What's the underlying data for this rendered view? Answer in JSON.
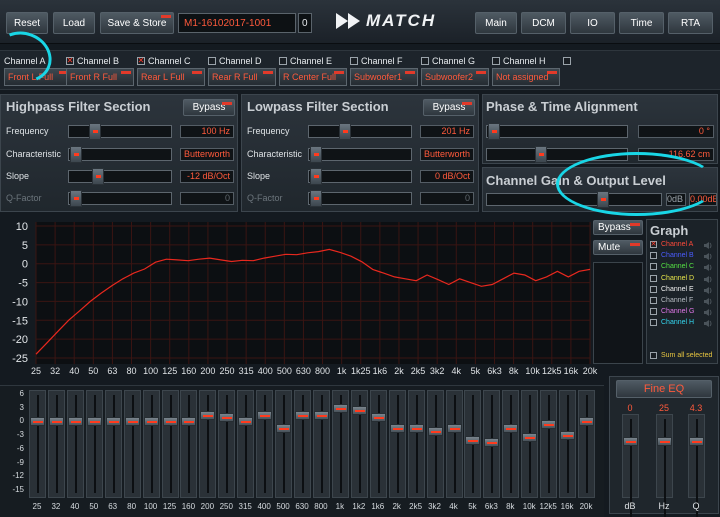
{
  "top": {
    "reset": "Reset",
    "load": "Load",
    "save_store": "Save & Store",
    "preset_name": "M1-16102017-1001",
    "preset_slot": "0",
    "logo": "MATCH",
    "nav": [
      "Main",
      "DCM",
      "IO",
      "Time",
      "RTA"
    ]
  },
  "channels": [
    {
      "name": "Channel A",
      "checked": false,
      "output": "Front L Full"
    },
    {
      "name": "Channel B",
      "checked": true,
      "output": "Front R Full"
    },
    {
      "name": "Channel C",
      "checked": true,
      "output": "Rear L Full"
    },
    {
      "name": "Channel D",
      "checked": false,
      "output": "Rear R Full"
    },
    {
      "name": "Channel E",
      "checked": false,
      "output": "R Center Full"
    },
    {
      "name": "Channel F",
      "checked": false,
      "output": "Subwoofer1"
    },
    {
      "name": "Channel G",
      "checked": false,
      "output": "Subwoofer2"
    },
    {
      "name": "Channel H",
      "checked": false,
      "output": "Not assigned"
    }
  ],
  "highpass": {
    "title": "Highpass Filter Section",
    "bypass": "Bypass",
    "labels": [
      "Frequency",
      "Characteristic",
      "Slope",
      "Q-Factor"
    ],
    "values": [
      "100 Hz",
      "Butterworth",
      "-12 dB/Oct",
      "0"
    ]
  },
  "lowpass": {
    "title": "Lowpass Filter Section",
    "bypass": "Bypass",
    "labels": [
      "Frequency",
      "Characteristic",
      "Slope",
      "Q-Factor"
    ],
    "values": [
      "201 Hz",
      "Butterworth",
      "0 dB/Oct",
      "0"
    ]
  },
  "phase": {
    "title": "Phase & Time Alignment",
    "phase_value": "0 °",
    "time_value": "116.62 cm"
  },
  "gain": {
    "title": "Channel Gain & Output Level",
    "left_value": "0dB",
    "right_value": "0.00dB"
  },
  "graph": {
    "y_ticks": [
      "10",
      "5",
      "0",
      "-5",
      "-10",
      "-15",
      "-20",
      "-25"
    ],
    "x_ticks": [
      "25",
      "32",
      "40",
      "50",
      "63",
      "80",
      "100",
      "125",
      "160",
      "200",
      "250",
      "315",
      "400",
      "500",
      "630",
      "800",
      "1k",
      "1k25",
      "1k6",
      "2k",
      "2k5",
      "3k2",
      "4k",
      "5k",
      "6k3",
      "8k",
      "10k",
      "12k5",
      "16k",
      "20k"
    ],
    "curve_db": [
      -24,
      -21,
      -18,
      -15,
      -12.5,
      -10,
      -7.8,
      -5.8,
      -4,
      -2.5,
      -1.4,
      0.4,
      1.2,
      1.0,
      0.8,
      1.2,
      1.5,
      1.0,
      0.6,
      0.9,
      0.8,
      1.5,
      2.0,
      2.5,
      2.4,
      2.9,
      3.2,
      3.8,
      3.0,
      2.0,
      0.5,
      -1.5,
      -2.5,
      -3.5,
      -4.0,
      -4.5,
      -3.0,
      -4.2,
      -5.5,
      -4.0,
      -5.0,
      -6.0,
      -5.5,
      -4.0,
      -2.5,
      -3.0,
      -4.5,
      -3.5,
      -2.0,
      -3.5,
      -2.0,
      -1.5
    ]
  },
  "side": {
    "bypass": "Bypass",
    "mute": "Mute",
    "graph_title": "Graph",
    "legend": [
      {
        "name": "Channel A",
        "color": "#ff4a3a",
        "checked": true
      },
      {
        "name": "Channel B",
        "color": "#4a5cff",
        "checked": false
      },
      {
        "name": "Channel C",
        "color": "#54e043",
        "checked": false
      },
      {
        "name": "Channel D",
        "color": "#e8e64a",
        "checked": false
      },
      {
        "name": "Channel E",
        "color": "#f0f0f0",
        "checked": false
      },
      {
        "name": "Channel F",
        "color": "#b6bcc2",
        "checked": false
      },
      {
        "name": "Channel G",
        "color": "#e077e8",
        "checked": false
      },
      {
        "name": "Channel H",
        "color": "#34d7f0",
        "checked": false
      }
    ],
    "sum_label": "Sum all selected"
  },
  "eq": {
    "y_ticks": [
      "6",
      "3",
      "0",
      "-3",
      "-6",
      "-9",
      "-12",
      "-15"
    ],
    "bands": [
      "25",
      "32",
      "40",
      "50",
      "63",
      "80",
      "100",
      "125",
      "160",
      "200",
      "250",
      "315",
      "400",
      "500",
      "630",
      "800",
      "1k",
      "1k2",
      "1k6",
      "2k",
      "2k5",
      "3k2",
      "4k",
      "5k",
      "6k3",
      "8k",
      "10k",
      "12k5",
      "16k",
      "20k"
    ],
    "gains_db": [
      0,
      0,
      0,
      0,
      0,
      0,
      0,
      0,
      0,
      1.5,
      1,
      0,
      1.5,
      -1.5,
      1.5,
      1.5,
      3,
      2.5,
      1,
      -1.5,
      -1.5,
      -2,
      -1.5,
      -4,
      -4.5,
      -1.5,
      -3.5,
      -0.5,
      -3,
      0
    ]
  },
  "fine_eq": {
    "title": "Fine EQ",
    "values": [
      "0",
      "25",
      "4.3"
    ],
    "labels": [
      "dB",
      "Hz",
      "Q"
    ]
  }
}
